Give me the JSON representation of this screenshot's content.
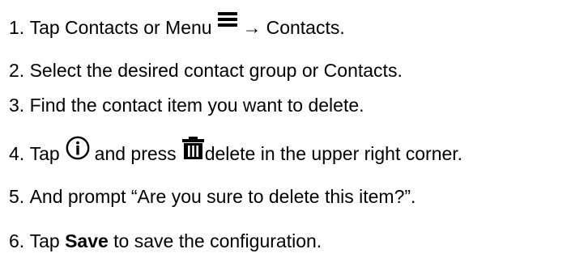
{
  "steps": [
    {
      "num": "1.",
      "text_before": "Tap Contacts or Menu",
      "icon": "menu-icon",
      "arrow": "→",
      "text_after": "Contacts."
    },
    {
      "num": "2.",
      "text": "Select the desired contact group or Contacts."
    },
    {
      "num": "3.",
      "text": "Find the contact item you want to delete."
    },
    {
      "num": "4.",
      "text_before": "Tap",
      "icon1": "info-icon",
      "text_middle": "and press",
      "icon2": "trash-icon",
      "text_after": "delete in the upper right corner."
    },
    {
      "num": "5.",
      "text": "And prompt “Are you sure to delete this item?”."
    },
    {
      "num": "6.",
      "text_before": "Tap",
      "bold": "Save",
      "text_after": "to save the configuration."
    }
  ]
}
